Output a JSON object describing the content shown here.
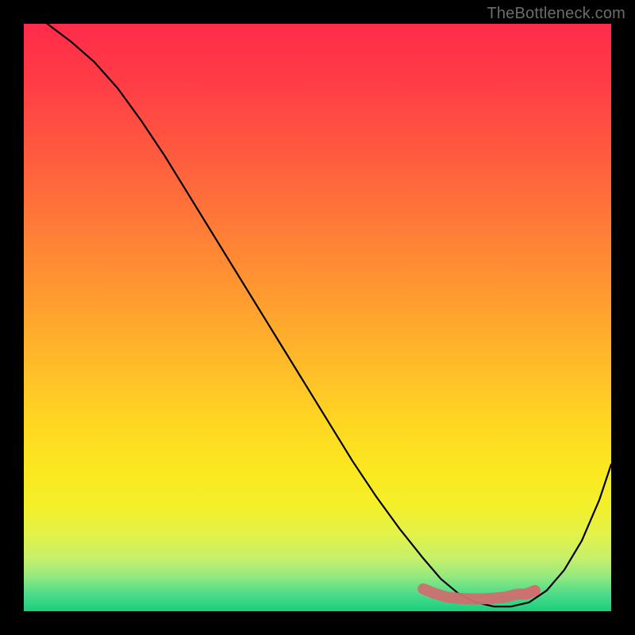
{
  "attribution": "TheBottleneck.com",
  "chart_data": {
    "type": "line",
    "title": "",
    "xlabel": "",
    "ylabel": "",
    "ylim": [
      0,
      100
    ],
    "xlim": [
      0,
      100
    ],
    "series": [
      {
        "name": "curve",
        "x": [
          4,
          8,
          12,
          16,
          20,
          24,
          28,
          32,
          36,
          40,
          44,
          48,
          52,
          56,
          60,
          64,
          68,
          71,
          74,
          77,
          80,
          83,
          86,
          89,
          92,
          95,
          98,
          100
        ],
        "y": [
          100,
          97,
          93.5,
          89,
          83.5,
          77.5,
          71,
          64.5,
          58,
          51.5,
          45,
          38.5,
          32,
          25.5,
          19.5,
          14,
          9,
          5.5,
          3,
          1.5,
          0.8,
          0.8,
          1.5,
          3.5,
          7,
          12,
          19,
          25
        ]
      }
    ],
    "markers": {
      "name": "bottom-scatter",
      "x": [
        68,
        70,
        72,
        74,
        76,
        78,
        80,
        82,
        84,
        85.5,
        87
      ],
      "y": [
        3.8,
        3.0,
        2.4,
        2.2,
        2.1,
        2.1,
        2.2,
        2.4,
        2.9,
        2.9,
        3.5
      ],
      "color": "#cf6f70",
      "r": 7
    }
  }
}
